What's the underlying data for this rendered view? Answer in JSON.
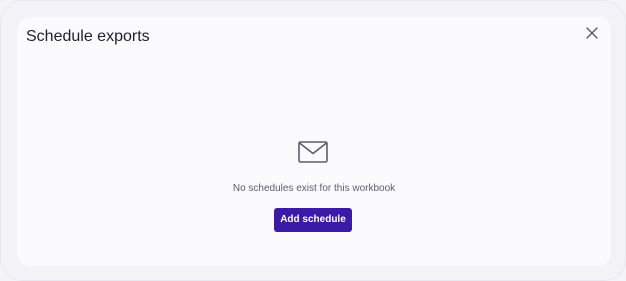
{
  "dialog": {
    "title": "Schedule exports",
    "close_icon": "close-icon"
  },
  "empty_state": {
    "icon": "mail-icon",
    "message": "No schedules exist for this workbook",
    "button_label": "Add schedule"
  },
  "colors": {
    "accent": "#3a1aa6",
    "icon": "#5c5c72"
  }
}
